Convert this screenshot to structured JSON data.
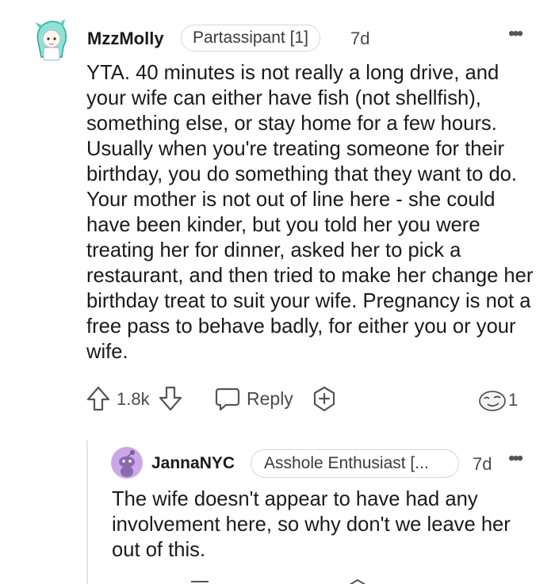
{
  "comment": {
    "username": "MzzMolly",
    "flair": "Partassipant [1]",
    "age": "7d",
    "body": "YTA. 40 minutes is not really a long drive, and your wife can either have fish (not shellfish), something else, or stay home for a few hours. Usually when you're treating someone for their birthday, you do something that they want to do. Your mother is not out of line here - she could have been kinder, but you told her you were treating her for dinner, asked her to pick a restaurant, and then tried to make her change her birthday treat to suit your wife. Pregnancy is not a free pass to behave badly, for either you or your wife.",
    "votes": "1.8k",
    "reply_label": "Reply",
    "award_count": "1",
    "more_label": "•••"
  },
  "reply": {
    "username": "JannaNYC",
    "flair": "Asshole Enthusiast [...",
    "age": "7d",
    "body": "The wife doesn't appear to have had any involvement here, so why don't we leave her out of this.",
    "more_label": "•••"
  },
  "colors": {
    "text": "#1a1a1b",
    "meta": "#4a4a4a",
    "border": "#d7d7d7",
    "snoo_purple": "#c9a7e8"
  }
}
